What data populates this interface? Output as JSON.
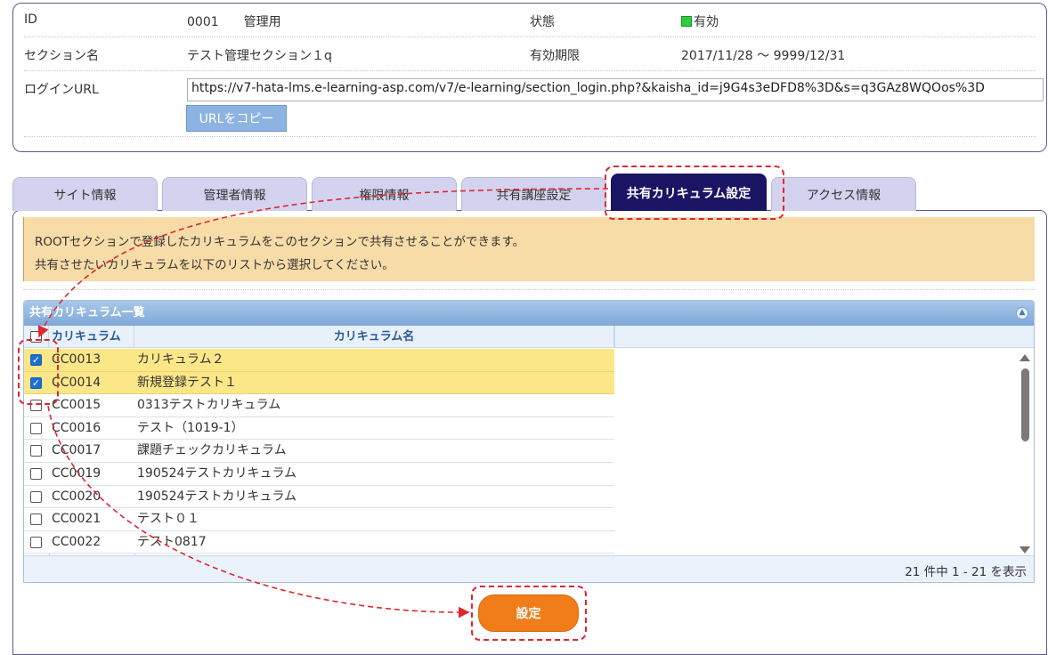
{
  "info": {
    "id_label": "ID",
    "id_value": "0001　　管理用",
    "status_label": "状態",
    "status_value": "有効",
    "section_label": "セクション名",
    "section_value": "テスト管理セクション１q",
    "expiry_label": "有効期限",
    "expiry_value": "2017/11/28 ～ 9999/12/31",
    "login_label": "ログインURL",
    "login_url": "https://v7-hata-lms.e-learning-asp.com/v7/e-learning/section_login.php?&kaisha_id=j9G4s3eDFD8%3D&s=q3GAz8WQOos%3D",
    "copy_button": "URLをコピー"
  },
  "tabs": [
    "サイト情報",
    "管理者情報",
    "権限情報",
    "共有講座設定",
    "共有カリキュラム設定",
    "アクセス情報"
  ],
  "active_tab": "共有カリキュラム設定",
  "notice": {
    "line1": "ROOTセクションで登録したカリキュラムをこのセクションで共有させることができます。",
    "line2": "共有させたいカリキュラムを以下のリストから選択してください。"
  },
  "grid": {
    "caption": "共有カリキュラム一覧",
    "col_code": "カリキュラム",
    "col_name": "カリキュラム名",
    "rows": [
      {
        "code": "CC0013",
        "name": "カリキュラム２",
        "checked": true
      },
      {
        "code": "CC0014",
        "name": "新規登録テスト１",
        "checked": true
      },
      {
        "code": "CC0015",
        "name": "0313テストカリキュラム",
        "checked": false
      },
      {
        "code": "CC0016",
        "name": "テスト（1019-1）",
        "checked": false
      },
      {
        "code": "CC0017",
        "name": "課題チェックカリキュラム",
        "checked": false
      },
      {
        "code": "CC0019",
        "name": "190524テストカリキュラム",
        "checked": false
      },
      {
        "code": "CC0020",
        "name": "190524テストカリキュラム",
        "checked": false
      },
      {
        "code": "CC0021",
        "name": "テスト０１",
        "checked": false
      },
      {
        "code": "CC0022",
        "name": "テスト0817",
        "checked": false
      }
    ],
    "footer": "21 件中 1 - 21 を表示"
  },
  "submit_button": "設定",
  "colors": {
    "active_tab": "#1a1464",
    "selected_row": "#fbe788",
    "submit": "#f07d1a",
    "annotation": "#e0262e"
  }
}
